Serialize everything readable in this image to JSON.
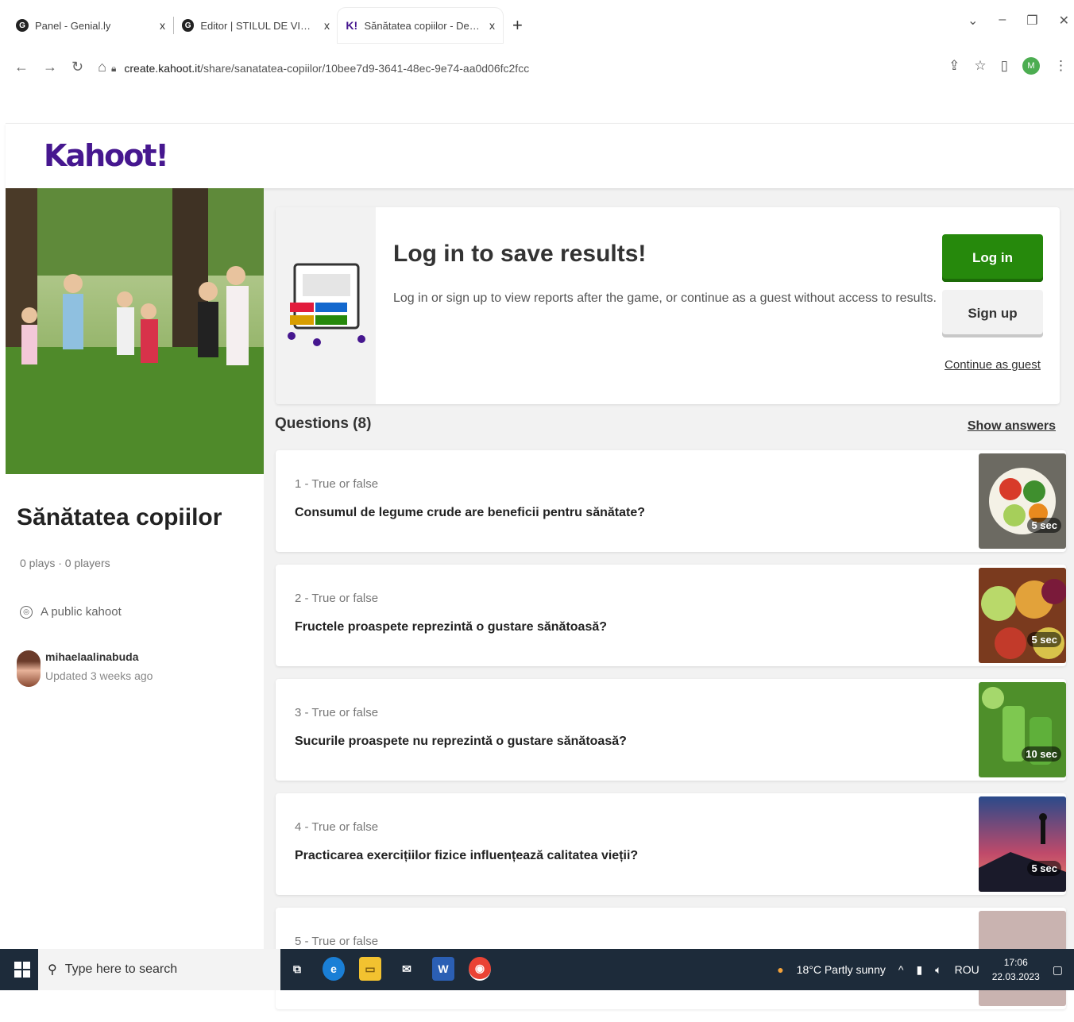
{
  "browser": {
    "tabs": [
      {
        "title": "Panel - Genial.ly",
        "icon": "genially-icon",
        "close": "x"
      },
      {
        "title": "Editor | STILUL DE VIAȚĂ SĂNĂTOS",
        "icon": "genially-icon",
        "close": "x"
      },
      {
        "title": "Sănătatea copiilor - Details - Kahoot!",
        "icon": "kahoot-icon",
        "close": "x"
      }
    ],
    "new_tab": "+",
    "url_host": "create.kahoot.it",
    "url_path": "/share/sanatatea-copiilor/10bee7d9-3641-48ec-9e74-aa0d06fc2fcc",
    "profile_initial": "M"
  },
  "kahoot": {
    "logo": "Kahoot!",
    "title": "Sănătatea copiilor",
    "stats": "0 plays · 0 players",
    "visibility": "A public kahoot",
    "author": "mihaelaalinabuda",
    "updated": "Updated 3 weeks ago"
  },
  "login_card": {
    "title": "Log in to save results!",
    "description": "Log in or sign up to view reports after the game, or continue as a guest without access to results.",
    "login_label": "Log in",
    "signup_label": "Sign up",
    "guest_label": "Continue as guest"
  },
  "questions": {
    "header": "Questions (8)",
    "show_answers": "Show answers",
    "items": [
      {
        "meta": "1 - True or false",
        "text": "Consumul de legume crude are beneficii pentru sănătate?",
        "time": "5 sec"
      },
      {
        "meta": "2 - True or false",
        "text": "Fructele proaspete reprezintă o gustare sănătoasă?",
        "time": "5 sec"
      },
      {
        "meta": "3 - True or false",
        "text": "Sucurile proaspete nu reprezintă o gustare sănătoasă?",
        "time": "10 sec"
      },
      {
        "meta": "4 - True or false",
        "text": "Practicarea exercițiilor fizice influențează calitatea vieții?",
        "time": "5 sec"
      },
      {
        "meta": "5 - True or false",
        "text": "",
        "time": ""
      }
    ]
  },
  "taskbar": {
    "search_placeholder": "Type here to search",
    "weather": "18°C  Partly sunny",
    "language": "ROU",
    "time": "17:06",
    "date": "22.03.2023"
  }
}
